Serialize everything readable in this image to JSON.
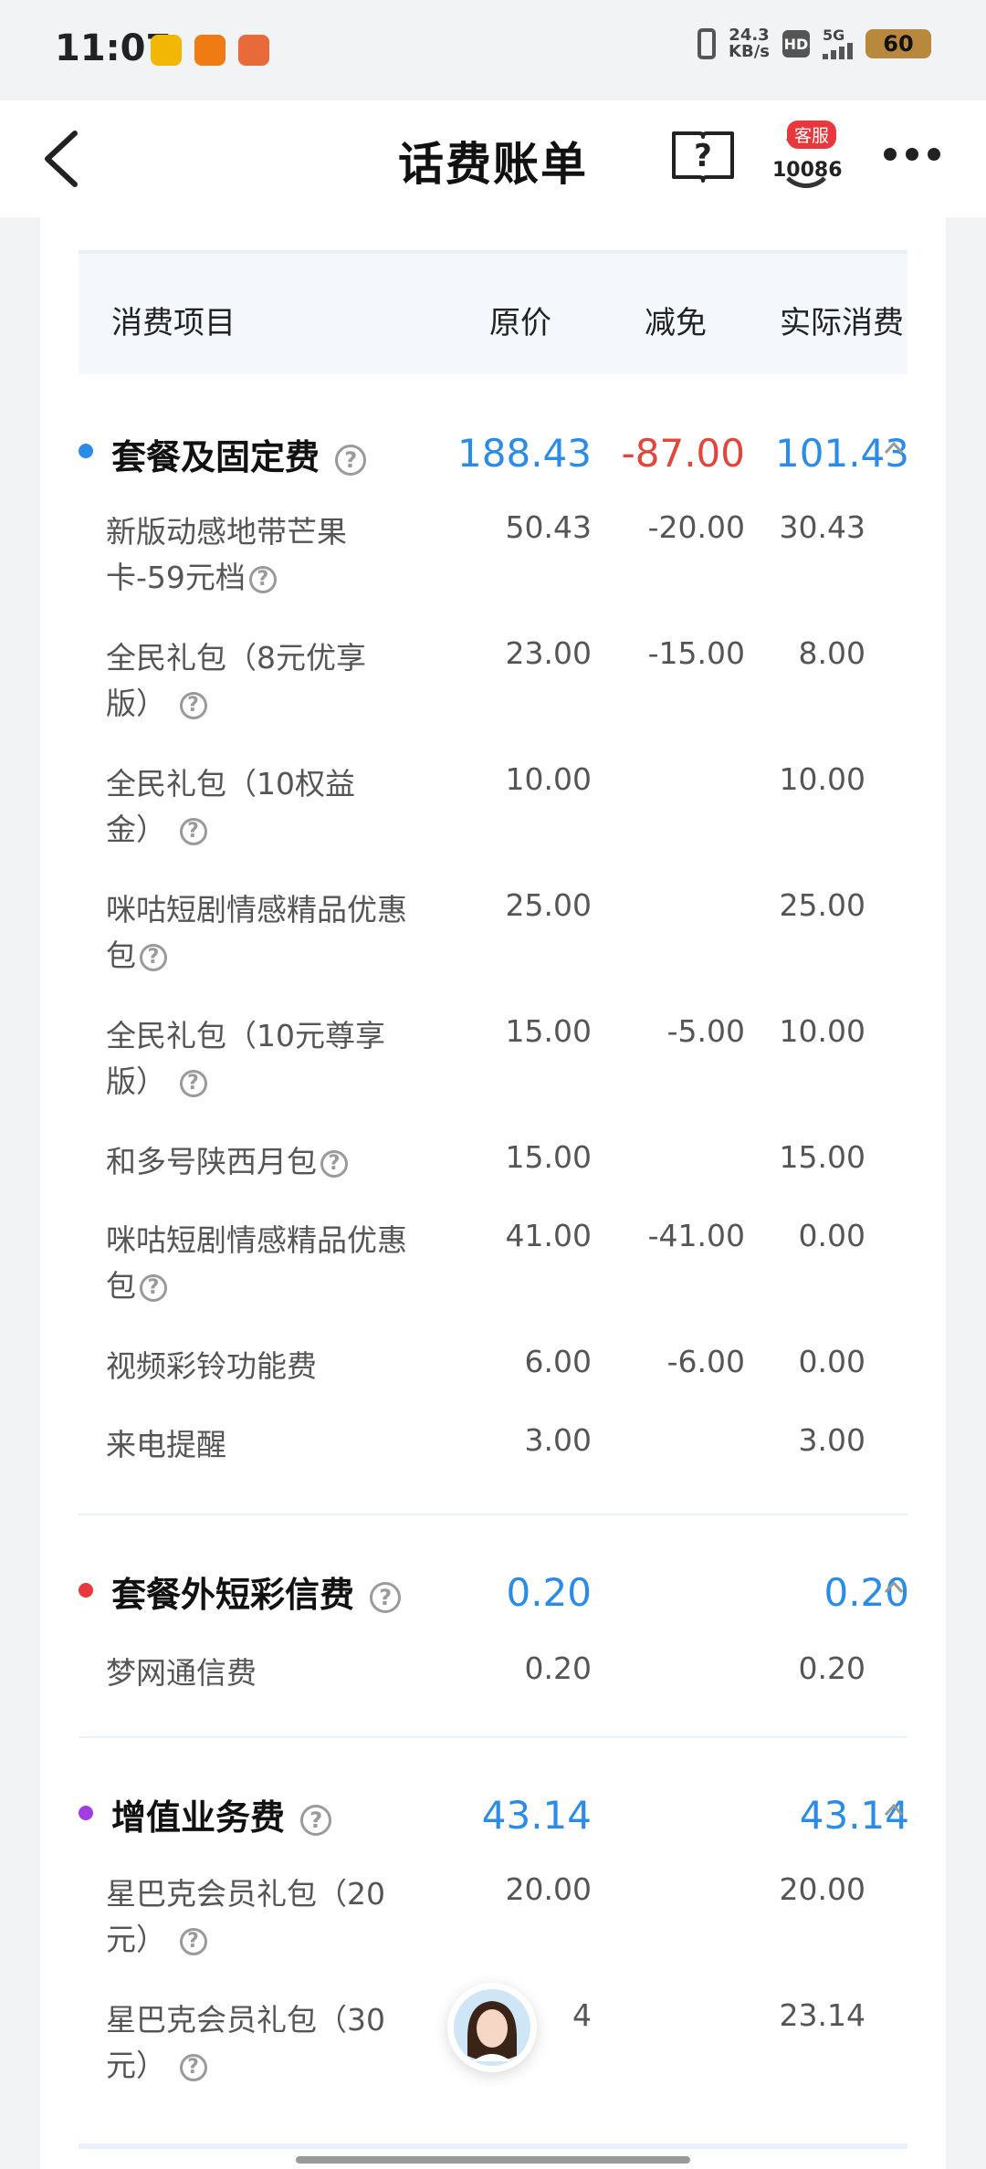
{
  "status_bar": {
    "time": "11:07",
    "net_speed": "24.3",
    "net_unit": "KB/s",
    "hd": "HD",
    "network": "5G",
    "battery": "60",
    "app_icons": [
      {
        "name": "app-icon-1",
        "color": "#f2b705"
      },
      {
        "name": "app-icon-2",
        "color": "#f07b12"
      },
      {
        "name": "app-icon-3",
        "color": "#e86a3a"
      }
    ]
  },
  "header": {
    "title": "话费账单",
    "help_icon": "question-book-icon",
    "cs_badge": "客服",
    "cs_number": "10086",
    "more_icon": "more-dots-icon"
  },
  "table": {
    "col_item": "消费项目",
    "col_original": "原价",
    "col_discount": "减免",
    "col_actual": "实际消费"
  },
  "sections": [
    {
      "title": "套餐及固定费",
      "dot_color": "#2b8ce8",
      "original": "188.43",
      "discount": "-87.00",
      "actual": "101.43",
      "items": [
        {
          "name": "新版动感地带芒果卡-59元档",
          "original": "50.43",
          "discount": "-20.00",
          "actual": "30.43"
        },
        {
          "name": "全民礼包（8元优享版）",
          "original": "23.00",
          "discount": "-15.00",
          "actual": "8.00"
        },
        {
          "name": "全民礼包（10权益金）",
          "original": "10.00",
          "discount": "",
          "actual": "10.00"
        },
        {
          "name": "咪咕短剧情感精品优惠包",
          "original": "25.00",
          "discount": "",
          "actual": "25.00"
        },
        {
          "name": "全民礼包（10元尊享版）",
          "original": "15.00",
          "discount": "-5.00",
          "actual": "10.00"
        },
        {
          "name": "和多号陕西月包",
          "original": "15.00",
          "discount": "",
          "actual": "15.00"
        },
        {
          "name": "咪咕短剧情感精品优惠包",
          "original": "41.00",
          "discount": "-41.00",
          "actual": "0.00"
        },
        {
          "name": "视频彩铃功能费",
          "original": "6.00",
          "discount": "-6.00",
          "actual": "0.00"
        },
        {
          "name": "来电提醒",
          "original": "3.00",
          "discount": "",
          "actual": "3.00"
        }
      ]
    },
    {
      "title": "套餐外短彩信费",
      "dot_color": "#e8373d",
      "original": "0.20",
      "discount": "",
      "actual": "0.20",
      "items": [
        {
          "name": "梦网通信费",
          "original": "0.20",
          "discount": "",
          "actual": "0.20"
        }
      ]
    },
    {
      "title": "增值业务费",
      "dot_color": "#a23ee0",
      "original": "43.14",
      "discount": "",
      "actual": "43.14",
      "items": [
        {
          "name": "星巴克会员礼包（20元）",
          "original": "20.00",
          "discount": "",
          "actual": "20.00"
        },
        {
          "name": "星巴克会员礼包（30元）",
          "original": "4",
          "discount": "",
          "actual": "23.14"
        }
      ]
    }
  ],
  "floating_assistant": "assistant-avatar"
}
